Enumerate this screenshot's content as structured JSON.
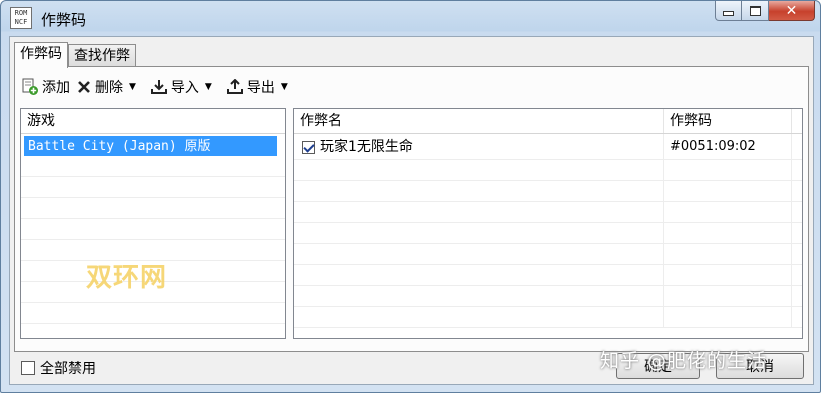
{
  "window": {
    "title": "作弊码",
    "icon_text": "ROM\nNCF"
  },
  "tabs": [
    {
      "label": "作弊码",
      "active": true
    },
    {
      "label": "查找作弊",
      "active": false
    }
  ],
  "toolbar": {
    "add": "添加",
    "delete": "删除",
    "import": "导入",
    "export": "导出"
  },
  "games": {
    "header": "游戏",
    "items": [
      "Battle City (Japan) 原版"
    ]
  },
  "cheats": {
    "columns": [
      "作弊名",
      "作弊码"
    ],
    "rows": [
      {
        "checked": true,
        "name": "玩家1无限生命",
        "code": "#0051:09:02"
      }
    ]
  },
  "footer": {
    "disable_all": "全部禁用",
    "ok": "确定",
    "cancel": "取消"
  },
  "watermarks": {
    "left": "双环网",
    "right": "知乎 @肥佬的生活"
  },
  "colors": {
    "selection": "#3399ff",
    "close_button": "#c7412c",
    "watermark": "#f6d36a"
  }
}
